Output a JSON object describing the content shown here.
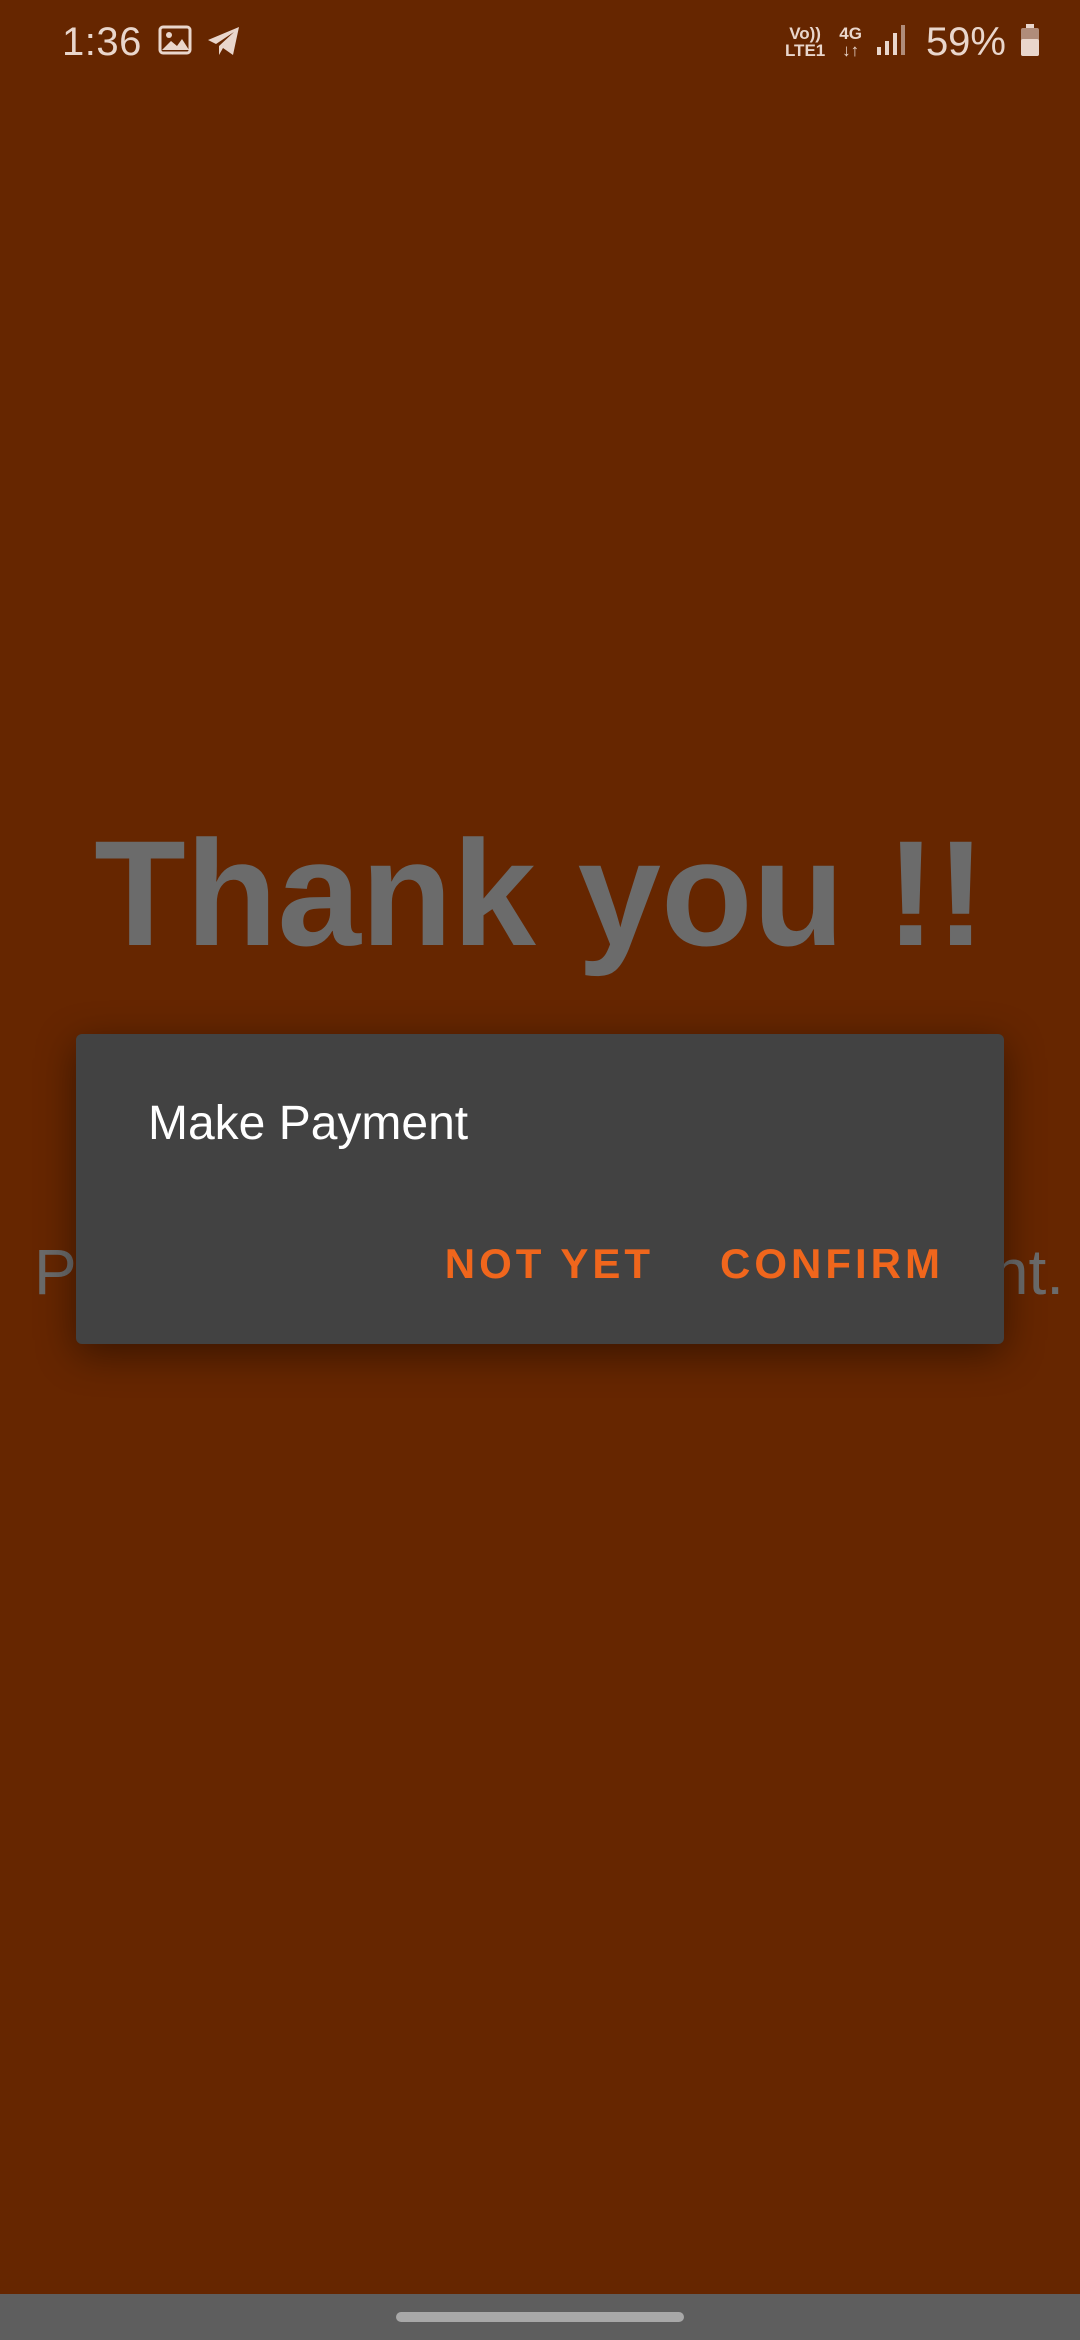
{
  "status_bar": {
    "time": "1:36",
    "network_top": "Vo))",
    "network_bottom": "LTE1",
    "data_top": "4G",
    "data_bottom": "↓↑",
    "battery": "59%"
  },
  "page": {
    "title": "Thank you !!",
    "subtitle_start": "P",
    "subtitle_end": "nt."
  },
  "dialog": {
    "title": "Make Payment",
    "not_yet": "NOT YET",
    "confirm": "CONFIRM"
  },
  "colors": {
    "background": "#662600",
    "dialog": "#424242",
    "accent": "#f0661c"
  }
}
